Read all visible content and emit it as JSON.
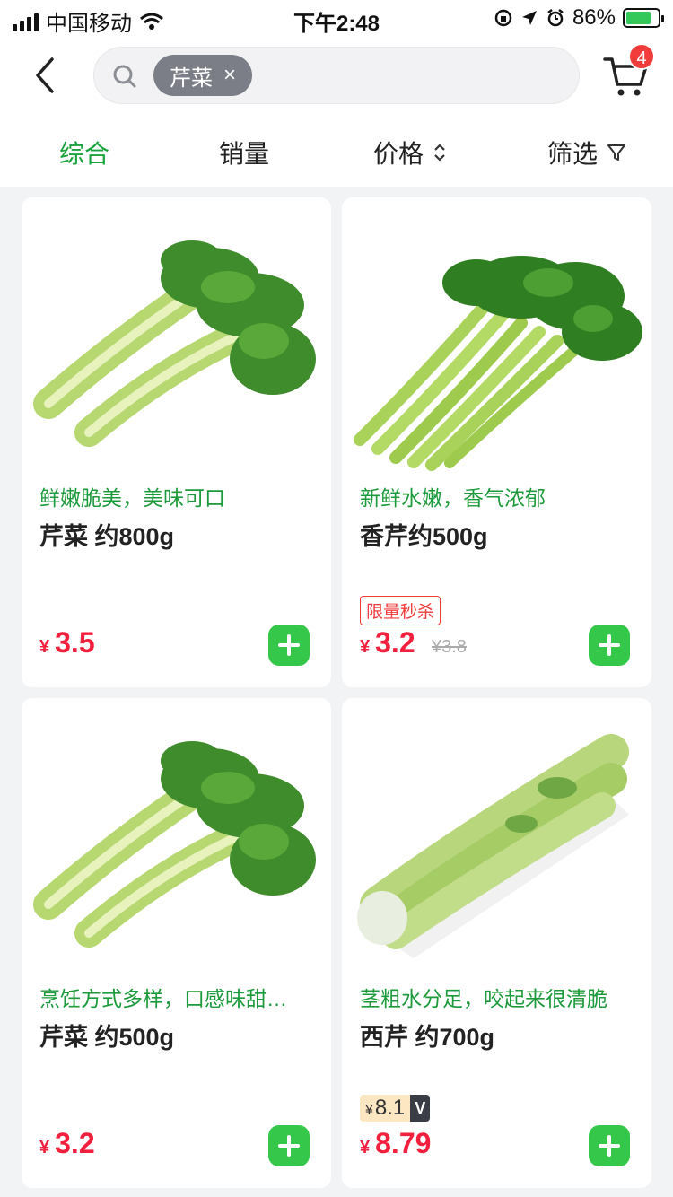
{
  "status_bar": {
    "carrier": "中国移动",
    "time": "下午2:48",
    "battery": "86%"
  },
  "search": {
    "chip_label": "芹菜",
    "chip_close": "×"
  },
  "cart": {
    "badge_count": "4"
  },
  "sort_tabs": {
    "comprehensive": "综合",
    "sales": "销量",
    "price": "价格",
    "filter": "筛选"
  },
  "products": [
    {
      "slogan": "鲜嫩脆美，美味可口",
      "name": "芹菜 约800g",
      "currency": "¥",
      "price": "3.5"
    },
    {
      "slogan": "新鲜水嫩，香气浓郁",
      "name": "香芹约500g",
      "tag": "限量秒杀",
      "currency": "¥",
      "price": "3.2",
      "original_price": "¥3.8"
    },
    {
      "slogan": "烹饪方式多样，口感味甜…",
      "name": "芹菜 约500g",
      "currency": "¥",
      "price": "3.2"
    },
    {
      "slogan": "茎粗水分足，咬起来很清脆",
      "name": "西芹 约700g",
      "vip_currency": "¥",
      "vip_price": "8.1",
      "vip_label": "V",
      "currency": "¥",
      "price": "8.79"
    }
  ],
  "colors": {
    "accent_green": "#1aa33c",
    "price_red": "#f2203c",
    "add_button": "#35c74a",
    "badge_red": "#f23b3b"
  }
}
